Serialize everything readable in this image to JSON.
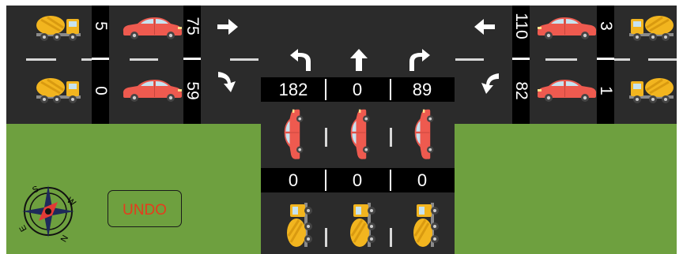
{
  "left_lanes": {
    "top": {
      "truck_count": "5",
      "car_count": "75"
    },
    "bottom": {
      "truck_count": "0",
      "car_count": "59"
    }
  },
  "right_lanes": {
    "top": {
      "car_count": "110",
      "truck_count": "3"
    },
    "bottom": {
      "car_count": "82",
      "truck_count": "1"
    }
  },
  "bottom_road": {
    "turn_arrows": [
      "turn-left-arrow",
      "straight-arrow",
      "turn-right-arrow"
    ],
    "car_counts": [
      "182",
      "0",
      "89"
    ],
    "truck_counts": [
      "0",
      "0",
      "0"
    ]
  },
  "controls": {
    "undo_label": "UNDO"
  },
  "colors": {
    "road": "#2b2b2b",
    "grass": "#6ea03f",
    "car": "#ee5a4f",
    "truck": "#f2b51f",
    "undo_text": "#e63b1d"
  }
}
